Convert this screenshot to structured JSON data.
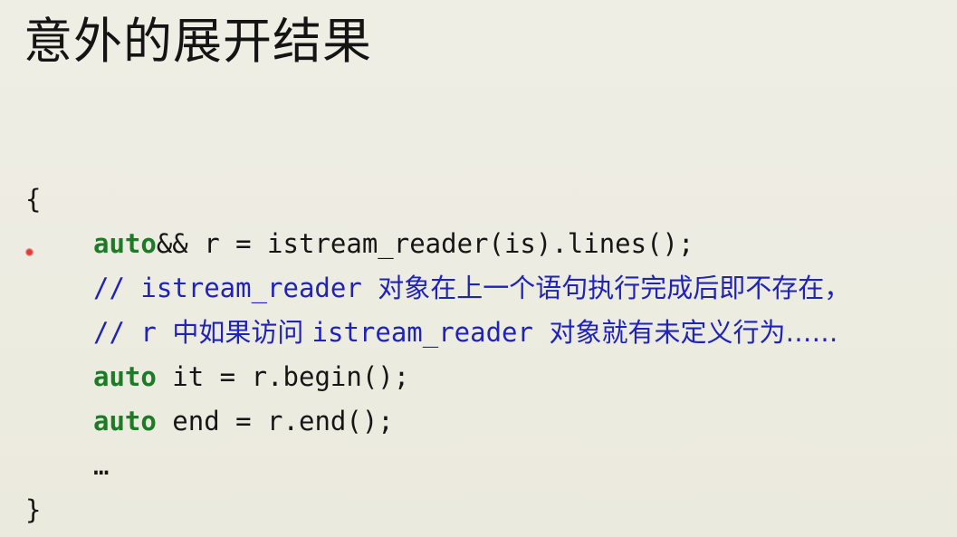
{
  "slide": {
    "title": "意外的展开结果"
  },
  "code": {
    "open_brace": "{",
    "line1": {
      "kw": "auto",
      "rest": "&& r = istream_reader(is).lines();"
    },
    "line2": {
      "prefix": "// istream_reader ",
      "cjk": "对象在上一个语句执行完成后即不存在，"
    },
    "line3": {
      "prefix": "// r ",
      "cjk1": "中如果访问 ",
      "mid": "istream_reader ",
      "cjk2": "对象就有未定义行为……"
    },
    "line4": {
      "kw": "auto",
      "rest": " it = r.begin();"
    },
    "line5": {
      "kw": "auto",
      "rest": " end = r.end();"
    },
    "line6": "…",
    "close_brace": "}"
  },
  "colors": {
    "keyword": "#1d7a27",
    "comment": "#1f23b9",
    "background": "#ecebe1",
    "pointer": "#e23a3a"
  }
}
